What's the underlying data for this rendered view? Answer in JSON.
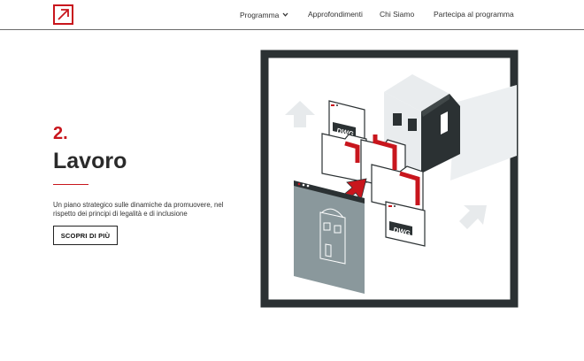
{
  "nav": {
    "items": [
      {
        "label": "Programma",
        "has_dropdown": true
      },
      {
        "label": "Approfondimenti"
      },
      {
        "label": "Chi Siamo"
      },
      {
        "label": "Partecipa al programma"
      }
    ]
  },
  "hero": {
    "number": "2.",
    "title": "Lavoro",
    "description": "Un piano strategico sulle dinamiche da promuovere, nel rispetto dei principi di legalità e di inclusione",
    "cta_label": "SCOPRI DI PIÙ"
  },
  "illustration": {
    "file_label_1": "DWG",
    "file_label_2": "DWG"
  },
  "colors": {
    "accent": "#c8161d",
    "text": "#2a2a2a",
    "frame": "#2b3133"
  },
  "icons": {
    "logo": "arrow-up-right-box-icon",
    "dropdown": "chevron-down-icon"
  }
}
